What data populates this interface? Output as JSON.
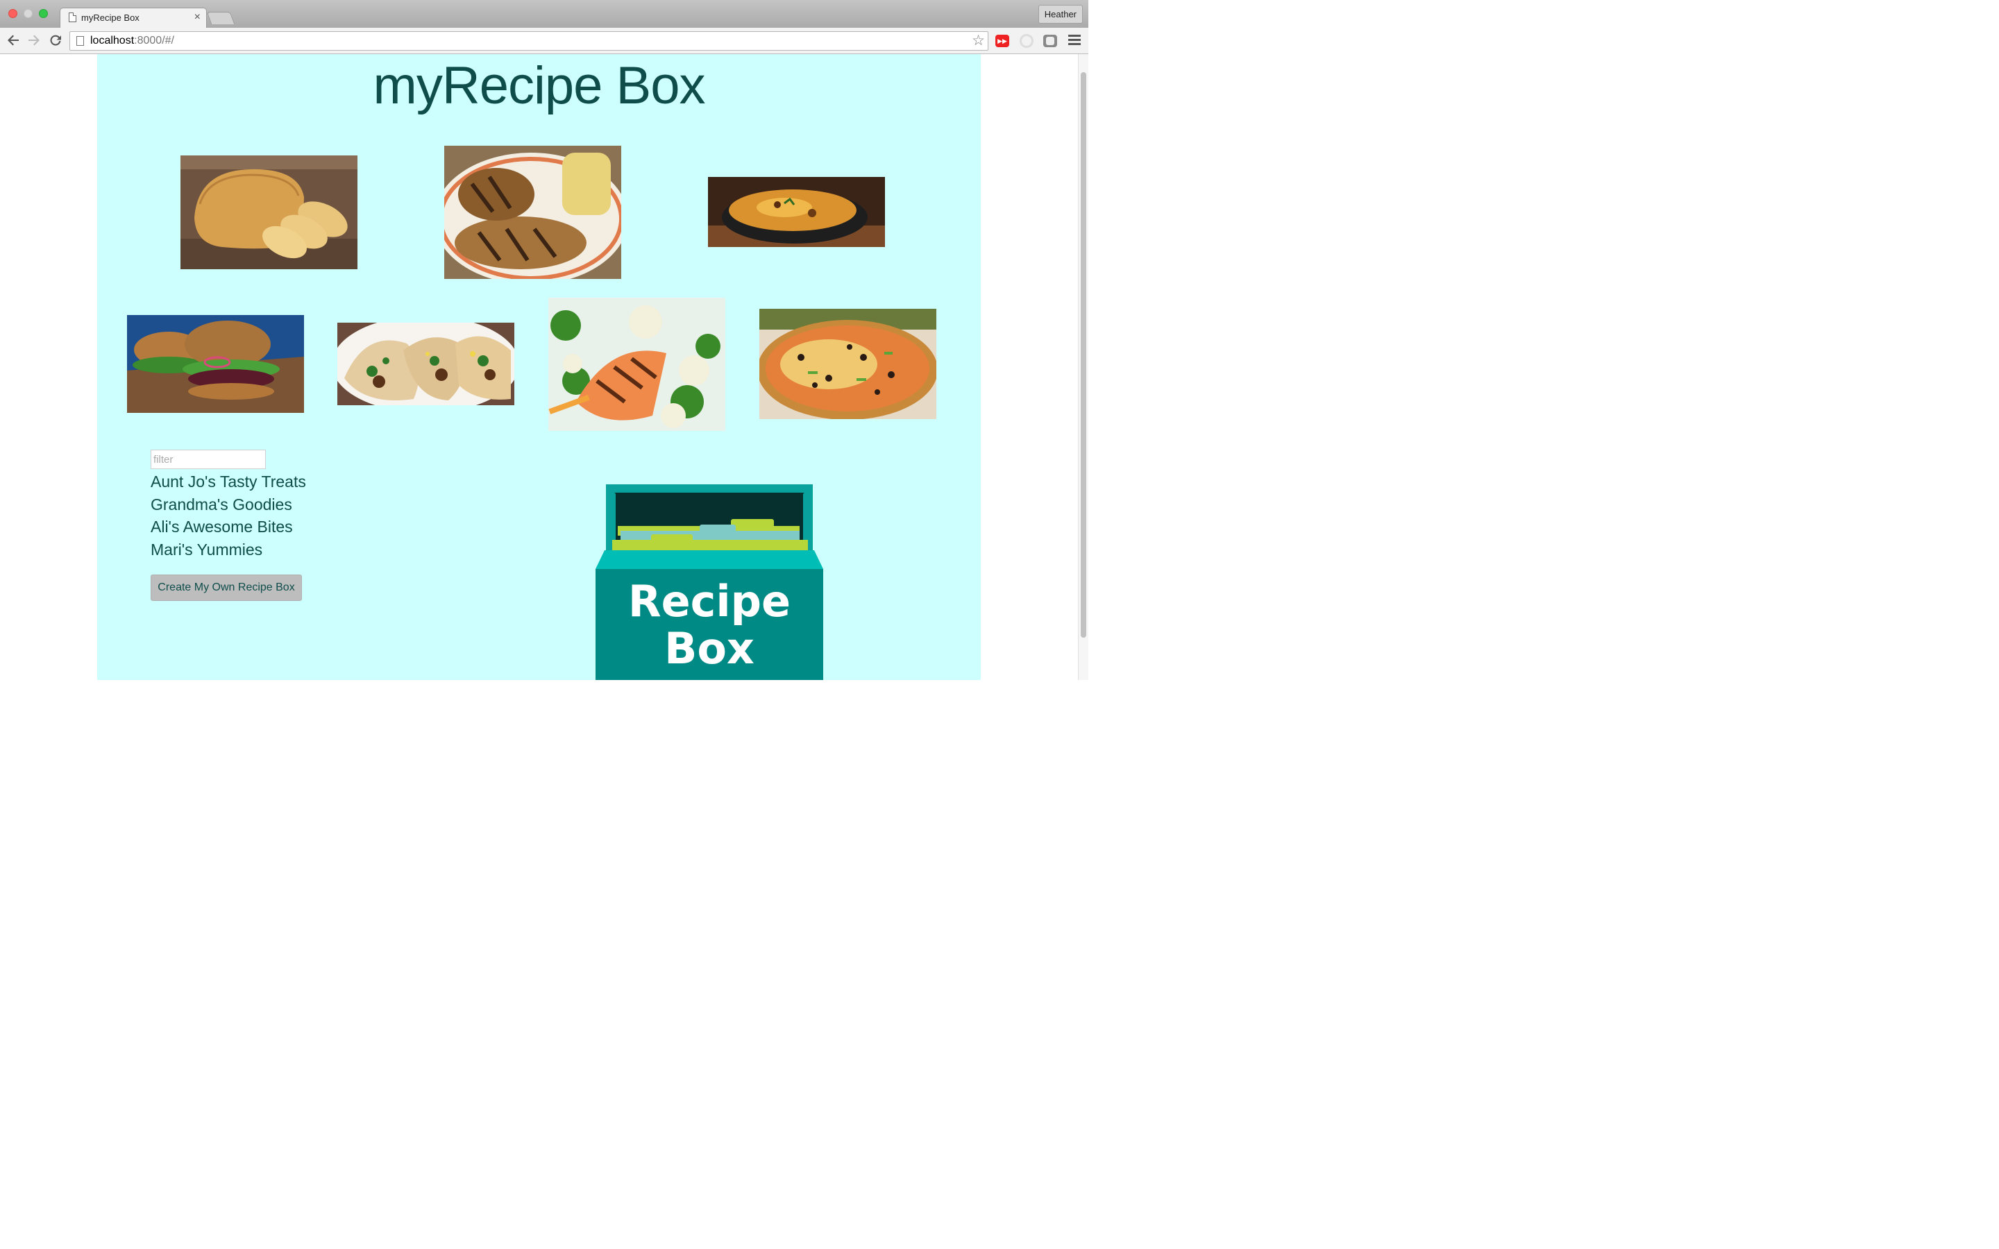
{
  "browser": {
    "tab_title": "myRecipe Box",
    "tab_close": "×",
    "profile_name": "Heather",
    "url_host": "localhost",
    "url_rest": ":8000/#/"
  },
  "page": {
    "title": "myRecipe Box",
    "filter_placeholder": "filter",
    "recipe_boxes": [
      "Aunt Jo's Tasty Treats",
      "Grandma's Goodies",
      "Ali's Awesome Bites",
      "Mari's Yummies"
    ],
    "create_button": "Create My Own Recipe Box",
    "logo_text_line1": "Recipe",
    "logo_text_line2": "Box"
  },
  "colors": {
    "page_background": "#ccfffd",
    "title_text": "#0e4d4a",
    "logo_teal": "#008a85"
  },
  "icons": [
    "page-icon",
    "back-arrow-icon",
    "forward-arrow-icon",
    "reload-icon",
    "bookmark-star-icon",
    "youtube-extension-icon",
    "extension-icon",
    "menu-icon"
  ]
}
